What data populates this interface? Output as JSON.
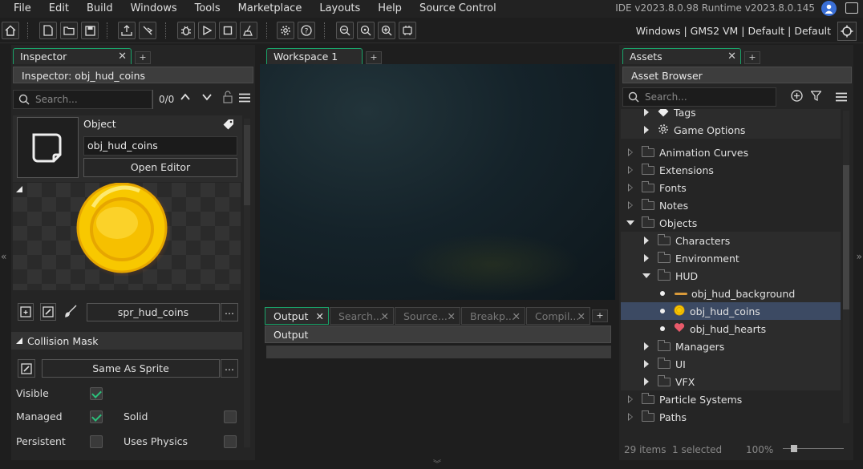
{
  "menu": [
    "File",
    "Edit",
    "Build",
    "Windows",
    "Tools",
    "Marketplace",
    "Layouts",
    "Help",
    "Source Control"
  ],
  "ide_version": "IDE v2023.8.0.98  Runtime v2023.8.0.145",
  "target_bar": "Windows  |  GMS2 VM  |  Default  |  Default",
  "inspector": {
    "tab": "Inspector",
    "header": "Inspector: obj_hud_coins",
    "search_placeholder": "Search...",
    "search_count": "0/0",
    "object_label": "Object",
    "object_name": "obj_hud_coins",
    "open_editor": "Open Editor",
    "sprite_name": "spr_hud_coins",
    "more": "...",
    "collision_header": "Collision Mask",
    "mask_value": "Same As Sprite",
    "visible_label": "Visible",
    "managed_label": "Managed",
    "solid_label": "Solid",
    "persistent_label": "Persistent",
    "physics_label": "Uses Physics",
    "visible": true,
    "managed": true,
    "solid": false,
    "persistent": false,
    "physics": false
  },
  "workspace": {
    "tab": "Workspace 1"
  },
  "output": {
    "tabs": [
      "Output",
      "Search...",
      "Source...",
      "Breakp...",
      "Compil..."
    ],
    "header": "Output"
  },
  "assets": {
    "tab": "Assets",
    "header": "Asset Browser",
    "search_placeholder": "Search...",
    "tree": [
      {
        "label": "Tags",
        "indent": 1,
        "state": "closed",
        "icon": "tag-icon"
      },
      {
        "label": "Game Options",
        "indent": 1,
        "state": "closed",
        "icon": "gear-icon"
      },
      {
        "label": "Animation Curves",
        "indent": 0,
        "state": "closed-outline",
        "icon": "folder"
      },
      {
        "label": "Extensions",
        "indent": 0,
        "state": "closed-outline",
        "icon": "folder"
      },
      {
        "label": "Fonts",
        "indent": 0,
        "state": "closed-outline",
        "icon": "folder"
      },
      {
        "label": "Notes",
        "indent": 0,
        "state": "closed-outline",
        "icon": "folder"
      },
      {
        "label": "Objects",
        "indent": 0,
        "state": "open",
        "icon": "folder"
      },
      {
        "label": "Characters",
        "indent": 1,
        "state": "closed",
        "icon": "folder"
      },
      {
        "label": "Environment",
        "indent": 1,
        "state": "closed",
        "icon": "folder"
      },
      {
        "label": "HUD",
        "indent": 1,
        "state": "open",
        "icon": "folder"
      },
      {
        "label": "obj_hud_background",
        "indent": 2,
        "state": "leaf",
        "icon": "bar"
      },
      {
        "label": "obj_hud_coins",
        "indent": 2,
        "state": "leaf",
        "icon": "coin",
        "selected": true
      },
      {
        "label": "obj_hud_hearts",
        "indent": 2,
        "state": "leaf",
        "icon": "heart"
      },
      {
        "label": "Managers",
        "indent": 1,
        "state": "closed",
        "icon": "folder"
      },
      {
        "label": "UI",
        "indent": 1,
        "state": "closed",
        "icon": "folder"
      },
      {
        "label": "VFX",
        "indent": 1,
        "state": "closed",
        "icon": "folder"
      },
      {
        "label": "Particle Systems",
        "indent": 0,
        "state": "closed-outline",
        "icon": "folder"
      },
      {
        "label": "Paths",
        "indent": 0,
        "state": "closed-outline",
        "icon": "folder"
      }
    ],
    "status_items": "29 items",
    "status_selected": "1 selected",
    "zoom": "100%"
  }
}
